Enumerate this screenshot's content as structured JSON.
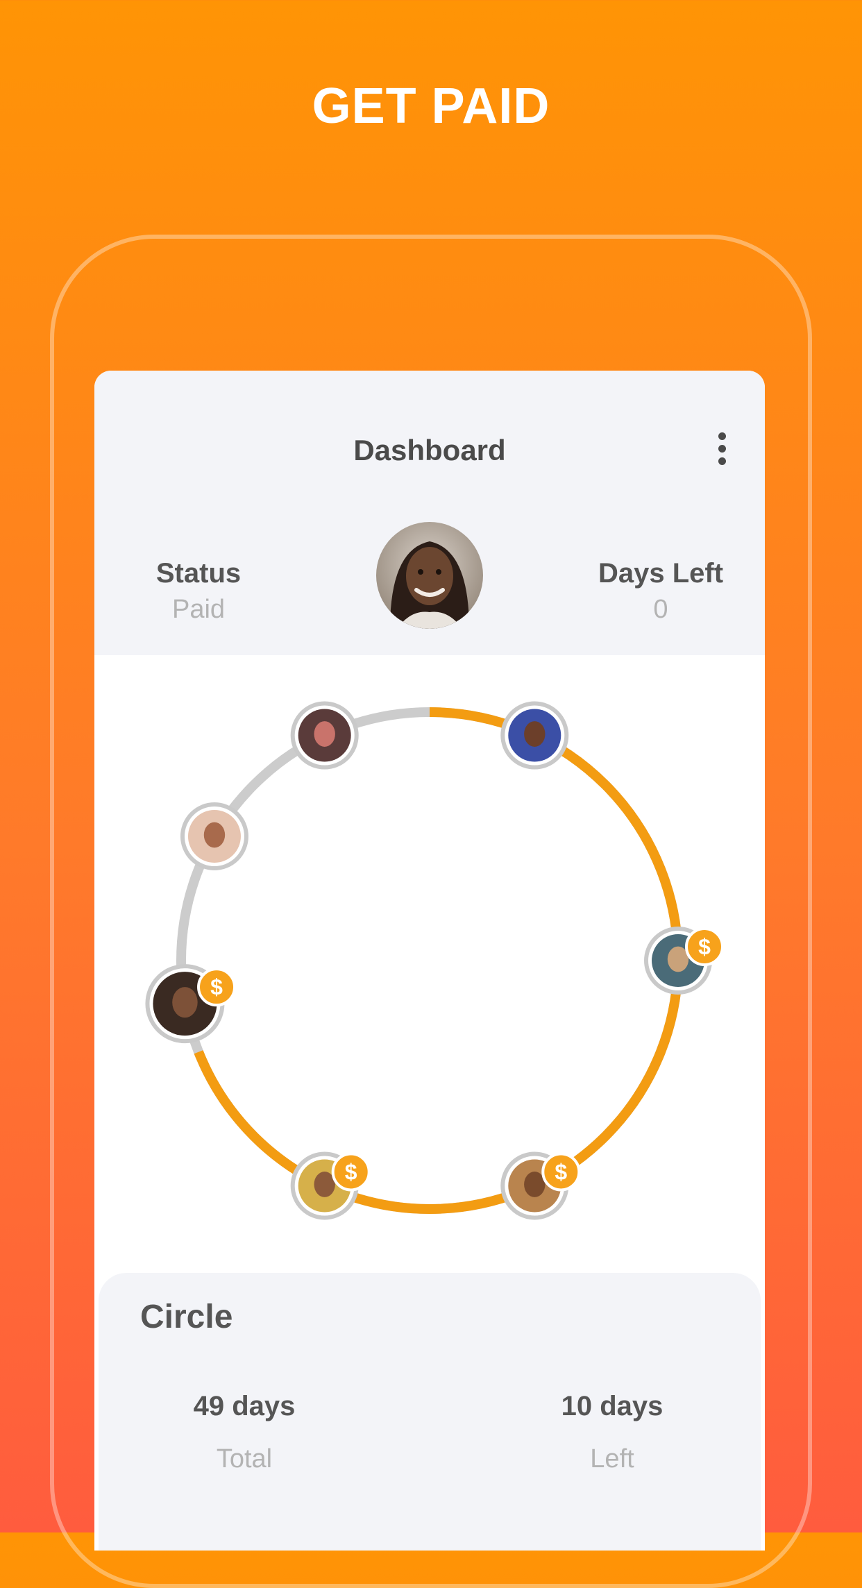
{
  "headline": "GET PAID",
  "nav": {
    "title": "Dashboard",
    "more_icon": "more-vertical-icon"
  },
  "status": {
    "label": "Status",
    "value": "Paid"
  },
  "days_left": {
    "label": "Days Left",
    "value": "0"
  },
  "circle": {
    "progress_fraction": 0.69,
    "track_color": "#CCCCCC",
    "progress_color": "#F39C12",
    "badge_color": "#F7A21B",
    "members": [
      {
        "name": "member-1",
        "paid": false
      },
      {
        "name": "member-2",
        "paid": false
      },
      {
        "name": "member-3",
        "paid": true
      },
      {
        "name": "member-4",
        "paid": true
      },
      {
        "name": "member-5",
        "paid": true
      },
      {
        "name": "member-6",
        "paid": true
      },
      {
        "name": "member-7",
        "paid": false
      }
    ],
    "badge_symbol": "$"
  },
  "summary": {
    "title": "Circle",
    "total": {
      "value": "49 days",
      "label": "Total"
    },
    "left": {
      "value": "10 days",
      "label": "Left"
    }
  },
  "colors": {
    "background_top": "#FF9405",
    "background_bottom": "#FF5C3E",
    "panel": "#F3F4F8"
  }
}
